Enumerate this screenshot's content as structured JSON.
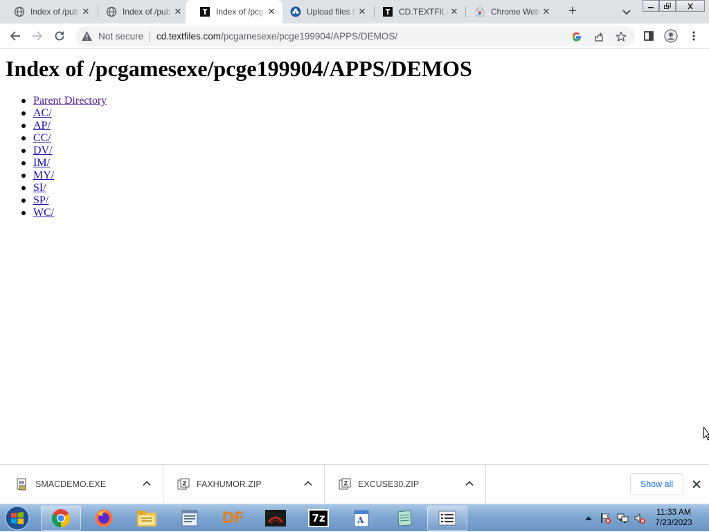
{
  "browser": {
    "tabs": [
      {
        "title": "Index of /pub",
        "favicon": "globe-icon",
        "active": false
      },
      {
        "title": "Index of /pub",
        "favicon": "globe-icon",
        "active": false
      },
      {
        "title": "Index of /pcg",
        "favicon": "textfiles-icon",
        "active": true
      },
      {
        "title": "Upload files t",
        "favicon": "upload-icon",
        "active": false
      },
      {
        "title": "CD.TEXTFILES",
        "favicon": "textfiles-icon",
        "active": false
      },
      {
        "title": "Chrome Web",
        "favicon": "webstore-icon",
        "active": false
      }
    ],
    "omnibox": {
      "security_label": "Not secure",
      "url_host": "cd.textfiles.com",
      "url_path": "/pcgamesexe/pcge199904/APPS/DEMOS/"
    }
  },
  "page": {
    "title": "Index of /pcgamesexe/pcge199904/APPS/DEMOS",
    "links": [
      {
        "label": "Parent Directory",
        "visited": true
      },
      {
        "label": "AC/",
        "visited": false
      },
      {
        "label": "AP/",
        "visited": false
      },
      {
        "label": "CC/",
        "visited": false
      },
      {
        "label": "DV/",
        "visited": false
      },
      {
        "label": "IM/",
        "visited": false
      },
      {
        "label": "MY/",
        "visited": false
      },
      {
        "label": "SI/",
        "visited": false
      },
      {
        "label": "SP/",
        "visited": false
      },
      {
        "label": "WC/",
        "visited": false
      }
    ]
  },
  "downloads": {
    "items": [
      {
        "filename": "SMACDEMO.EXE",
        "icon": "exe-file-icon"
      },
      {
        "filename": "FAXHUMOR.ZIP",
        "icon": "zip-file-icon"
      },
      {
        "filename": "EXCUSE30.ZIP",
        "icon": "zip-file-icon"
      }
    ],
    "show_all_label": "Show all"
  },
  "taskbar": {
    "apps": [
      "chrome-icon",
      "firefox-icon",
      "explorer-icon",
      "notepad-icon",
      "df-icon",
      "game-icon",
      "7zip-icon",
      "wordpad-icon",
      "notepad2-icon",
      "list-app-icon"
    ],
    "df_label": "DF",
    "sevenzip_label": "7z",
    "clock_time": "11:33 AM",
    "clock_date": "7/23/2023"
  },
  "colors": {
    "link": "#1a0dab",
    "visited_link": "#551a8b",
    "accent": "#1a73e8",
    "tabstrip": "#dee1e6"
  }
}
